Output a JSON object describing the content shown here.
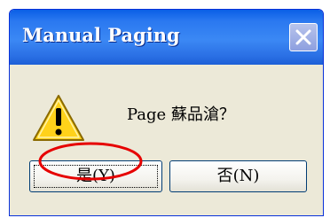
{
  "dialog": {
    "title": "Manual Paging",
    "close_icon": "close-icon",
    "message": "Page 蘇品滄？",
    "icon": "warning-icon"
  },
  "buttons": {
    "yes_label": "是(Y)",
    "no_label": "否(N)"
  },
  "colors": {
    "titlebar": "#2a78f0",
    "dialog_bg": "#ece9d8",
    "highlight": "#e60000",
    "warning_yellow": "#ffd21a"
  }
}
